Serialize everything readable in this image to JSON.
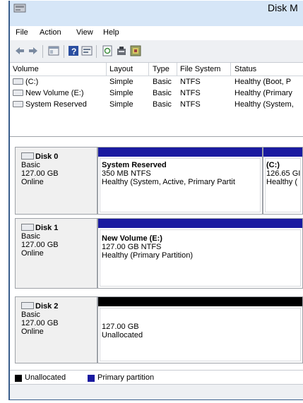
{
  "window": {
    "title": "Disk M"
  },
  "menu": [
    {
      "label": "File"
    },
    {
      "label": "Action"
    },
    {
      "label": "View"
    },
    {
      "label": "Help"
    }
  ],
  "toolbar": {
    "icons": [
      "back-arrow-icon",
      "forward-arrow-icon",
      "console-tree-icon",
      "help-icon",
      "help-topics-icon",
      "refresh-icon",
      "properties-icon",
      "rescan-icon"
    ]
  },
  "volume_table": {
    "headers": [
      "Volume",
      "Layout",
      "Type",
      "File System",
      "Status"
    ],
    "rows": [
      {
        "volume": "(C:)",
        "layout": "Simple",
        "type": "Basic",
        "fs": "NTFS",
        "status": "Healthy (Boot, P"
      },
      {
        "volume": "New Volume (E:)",
        "layout": "Simple",
        "type": "Basic",
        "fs": "NTFS",
        "status": "Healthy (Primary"
      },
      {
        "volume": "System Reserved",
        "layout": "Simple",
        "type": "Basic",
        "fs": "NTFS",
        "status": "Healthy (System,"
      }
    ]
  },
  "disks": [
    {
      "name": "Disk 0",
      "kind": "Basic",
      "size": "127.00 GB",
      "state": "Online",
      "partitions": [
        {
          "name": "System Reserved",
          "detail": "350 MB NTFS",
          "status": "Healthy (System, Active, Primary Partit"
        },
        {
          "name": "(C:)",
          "detail": "126.65 GI",
          "status": "Healthy ("
        }
      ]
    },
    {
      "name": "Disk 1",
      "kind": "Basic",
      "size": "127.00 GB",
      "state": "Online",
      "partitions": [
        {
          "name": "New Volume  (E:)",
          "detail": "127.00 GB NTFS",
          "status": "Healthy (Primary Partition)"
        }
      ]
    },
    {
      "name": "Disk 2",
      "kind": "Basic",
      "size": "127.00 GB",
      "state": "Online",
      "partitions": [
        {
          "name": "",
          "detail": "127.00 GB",
          "status": "Unallocated"
        }
      ]
    }
  ],
  "legend": [
    {
      "label": "Unallocated",
      "color": "#000000"
    },
    {
      "label": "Primary partition",
      "color": "#00008b"
    }
  ],
  "colors": {
    "primary": "#1a1aa0",
    "unallocated": "#000000",
    "titlebar": "#d6e6f7"
  }
}
